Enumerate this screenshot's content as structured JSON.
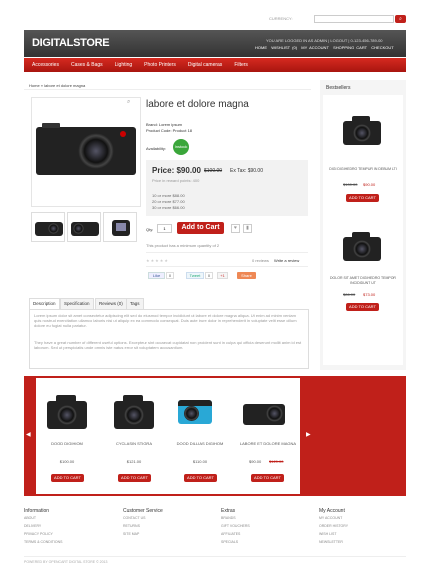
{
  "top": {
    "currency": "CURRENCY:",
    "search_placeholder": ""
  },
  "brand": {
    "logo": "DIGITALSTORE"
  },
  "account": {
    "welcome": "YOU ARE LOGGED IN AS ADMIN",
    "logout": "LOGOUT",
    "phone": "0-123-456-789-00",
    "links": [
      "HOME",
      "WISHLIST (0)",
      "MY ACCOUNT",
      "SHOPPING CART",
      "CHECKOUT"
    ]
  },
  "nav": [
    "Accessories",
    "Cases & Bags",
    "Lighting",
    "Photo Printers",
    "Digital cameras",
    "Filters"
  ],
  "breadcrumb": "Home » labore et dolore magna",
  "product": {
    "title": "labore et dolore magna",
    "brand": "Brand: Lorem ipsum",
    "code": "Product Code: Product 18",
    "availability_label": "Availability:",
    "availability": "Instock",
    "price_label": "Price:",
    "price": "$90.00",
    "old_price": "$100.00",
    "ex_tax": "Ex Tax: $90.00",
    "reward": "Price in reward points: 400",
    "discounts": [
      "10 or more $88.00",
      "20 or more $77.00",
      "30 or more $66.00"
    ],
    "qty_label": "Qty:",
    "qty": "1",
    "add_to_cart": "Add to Cart",
    "min_note": "This product has a minimum quantity of 2",
    "reviews": "0 reviews",
    "write_review": "Write a review",
    "share": [
      "Like",
      "Tweet",
      "+1",
      "Share"
    ],
    "share_counts": [
      "0",
      "0"
    ]
  },
  "tabs": [
    "Description",
    "Specification",
    "Reviews (0)",
    "Tags"
  ],
  "description": [
    "Lorem ipsum dolor sit amet consectetur adipiscing elit sed do eiusmod tempor incididunt ut labore et dolore magna aliqua. Ut enim ad minim veniam quis nostrud exercitation ullamco laboris nisi ut aliquip ex ea commodo consequat. Duis aute irure dolor in reprehenderit in voluptate velit esse cillum dolore eu fugiat nulla pariatur.",
    "They have a great number of different useful options. Excepteur sint occaecat cupidatat non proident sunt in culpa qui officia deserunt mollit anim id est laborum. Sed ut perspiciatis unde omnis iste natus error sit voluptatem accusantium."
  ],
  "bestsellers": {
    "title": "Bestsellers",
    "items": [
      {
        "name": "DIGI DIGIHEDRO TEMPUR IN DEBUM LTI",
        "old": "$100.00",
        "price": "$90.00",
        "cta": "ADD TO CART"
      },
      {
        "name": "DOLOR SIT AMET DIGIHEDRO TEMPOR INCIDIDUNT UT",
        "old": "$86.00",
        "price": "$73.00",
        "cta": "ADD TO CART"
      }
    ]
  },
  "carousel": [
    {
      "name": "DOOD DIGIHIOM",
      "price": "$100.00",
      "old": "",
      "cta": "ADD TO CART"
    },
    {
      "name": "CYCLASIN STIGRA",
      "price": "$121.00",
      "old": "",
      "cta": "ADD TO CART"
    },
    {
      "name": "DOOD DILLIAS DIGIHOM",
      "price": "$110.00",
      "old": "",
      "cta": "ADD TO CART"
    },
    {
      "name": "LABORE ET DOLORE MAGNA",
      "price": "$90.00",
      "old": "$120.00",
      "cta": "ADD TO CART"
    }
  ],
  "footer": {
    "cols": [
      {
        "title": "Information",
        "links": [
          "ABOUT",
          "DELIVERY",
          "PRIVACY POLICY",
          "TERMS & CONDITIONS"
        ]
      },
      {
        "title": "Customer Service",
        "links": [
          "CONTACT US",
          "RETURNS",
          "SITE MAP"
        ]
      },
      {
        "title": "Extras",
        "links": [
          "BRANDS",
          "GIFT VOUCHERS",
          "AFFILIATES",
          "SPECIALS"
        ]
      },
      {
        "title": "My Account",
        "links": [
          "MY ACCOUNT",
          "ORDER HISTORY",
          "WISH LIST",
          "NEWSLETTER"
        ]
      }
    ],
    "powered": "POWERED BY OPENCART DIGITAL STORE © 2013"
  },
  "colors": {
    "accent": "#c0201a",
    "header": "#3d3d3d",
    "instock": "#3aa63a"
  }
}
